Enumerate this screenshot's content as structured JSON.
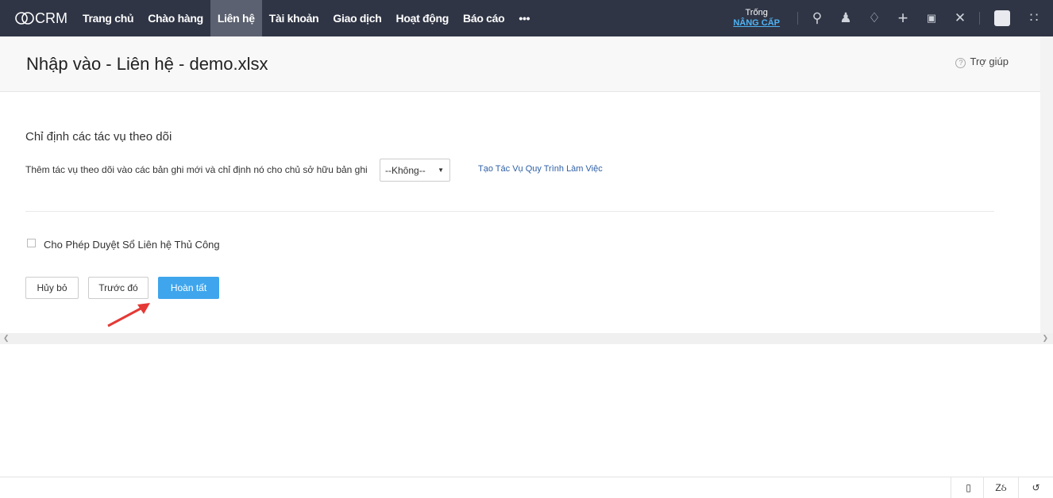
{
  "app": {
    "logo": "CRM"
  },
  "nav": [
    {
      "label": "Trang chủ"
    },
    {
      "label": "Chào hàng"
    },
    {
      "label": "Liên hệ",
      "active": true
    },
    {
      "label": "Tài khoản"
    },
    {
      "label": "Giao dịch"
    },
    {
      "label": "Hoạt động"
    },
    {
      "label": "Báo cáo"
    },
    {
      "label": "•••"
    }
  ],
  "plan": {
    "label": "Trống",
    "upgrade": "NÂNG CẤP"
  },
  "page": {
    "title": "Nhập vào - Liên hệ - demo.xlsx",
    "help": "Trợ giúp"
  },
  "followup": {
    "heading": "Chỉ định các tác vụ theo dõi",
    "label": "Thêm tác vụ theo dõi vào các bản ghi mới và chỉ định nó cho chủ sở hữu bản ghi",
    "select_value": "--Không--",
    "link": "Tạo Tác Vụ Quy Trình Làm Việc"
  },
  "manual": {
    "label": "Cho Phép Duyệt Sổ Liên hệ Thủ Công",
    "checked": false
  },
  "buttons": {
    "cancel": "Hủy bỏ",
    "previous": "Trước đó",
    "finish": "Hoàn tất"
  },
  "colors": {
    "topbar": "#2f3545",
    "primary": "#3fa6ed",
    "annotation_arrow": "#e53935"
  }
}
